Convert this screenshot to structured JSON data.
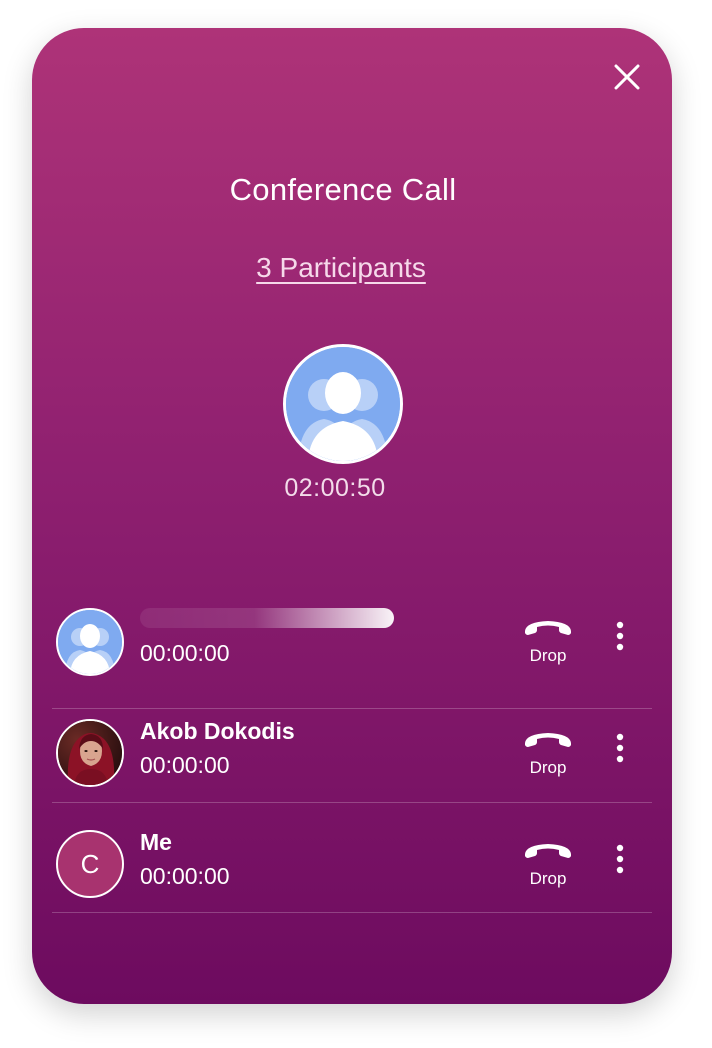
{
  "call": {
    "title": "Conference Call",
    "participants_link": "3 Participants",
    "duration": "02:00:50",
    "avatar_icon": "group-avatar-icon",
    "close_icon": "close-icon"
  },
  "participants": [
    {
      "name": "",
      "time": "00:00:00",
      "avatar": "group-avatar-icon",
      "loading": true,
      "drop_label": "Drop"
    },
    {
      "name": "Akob Dokodis",
      "time": "00:00:00",
      "avatar": "photo",
      "drop_label": "Drop"
    },
    {
      "name": "Me",
      "time": "00:00:00",
      "avatar_initial": "C",
      "drop_label": "Drop"
    }
  ],
  "colors": {
    "gradient_top": "#ae3378",
    "gradient_bottom": "#6d0b5f",
    "avatar_blue": "#7faaf0",
    "initial_avatar": "#a8336f"
  }
}
